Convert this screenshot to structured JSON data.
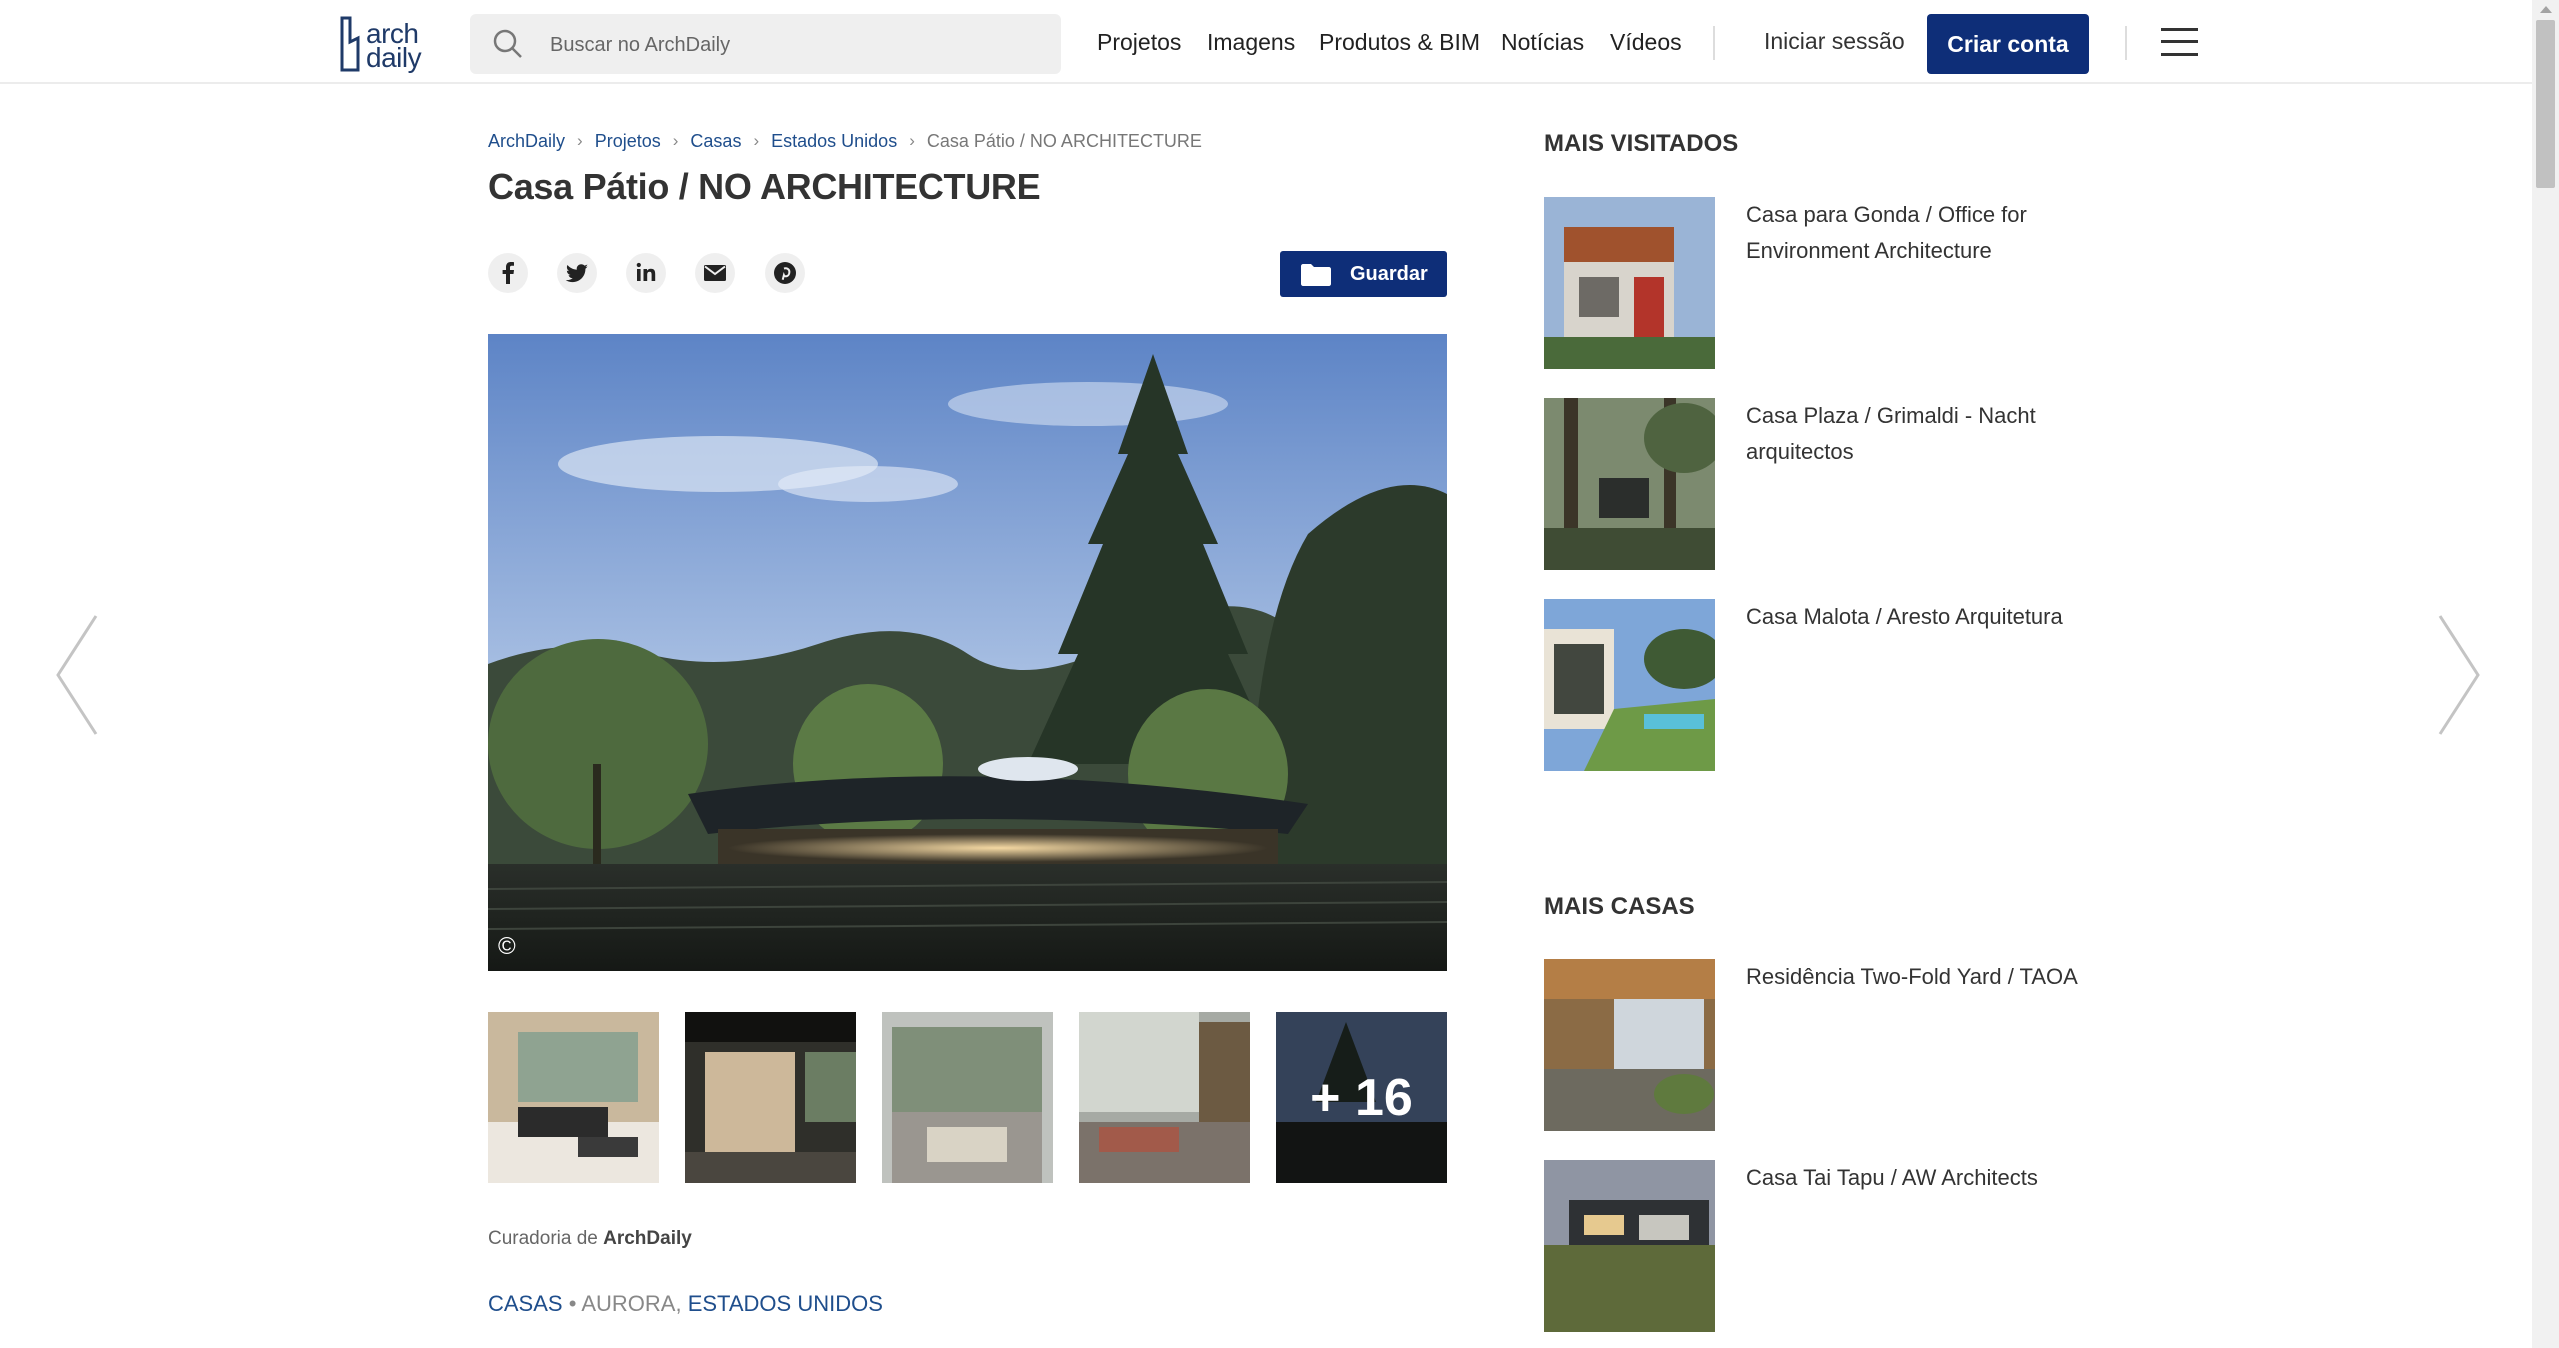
{
  "header": {
    "logo_top": "arch",
    "logo_bottom": "daily",
    "search_placeholder": "Buscar no ArchDaily",
    "nav": [
      "Projetos",
      "Imagens",
      "Produtos & BIM",
      "Notícias",
      "Vídeos"
    ],
    "login": "Iniciar sessão",
    "create_account": "Criar conta"
  },
  "breadcrumb": [
    "ArchDaily",
    "Projetos",
    "Casas",
    "Estados Unidos",
    "Casa Pátio / NO ARCHITECTURE"
  ],
  "article": {
    "title": "Casa Pátio / NO ARCHITECTURE",
    "save_label": "Guardar",
    "share_icons": [
      "facebook-icon",
      "twitter-icon",
      "linkedin-icon",
      "email-icon",
      "pinterest-icon"
    ],
    "copyright_symbol": "©",
    "more_photos": "+ 16",
    "curator_prefix": "Curadoria de",
    "curator_name": "ArchDaily",
    "tag_category": "CASAS",
    "tag_separator": "•",
    "tag_city": "AURORA,",
    "tag_country": "ESTADOS UNIDOS"
  },
  "sidebar": {
    "most_visited_title": "MAIS VISITADOS",
    "most_visited": [
      "Casa para Gonda / Office for Environment Architecture",
      "Casa Plaza / Grimaldi - Nacht arquitectos",
      "Casa Malota / Aresto Arquitetura"
    ],
    "more_houses_title": "MAIS CASAS",
    "more_houses": [
      "Residência Two-Fold Yard / TAOA",
      "Casa Tai Tapu / AW Architects"
    ]
  },
  "colors": {
    "brand_blue": "#0e2e78",
    "link_blue": "#1f4e8c"
  }
}
